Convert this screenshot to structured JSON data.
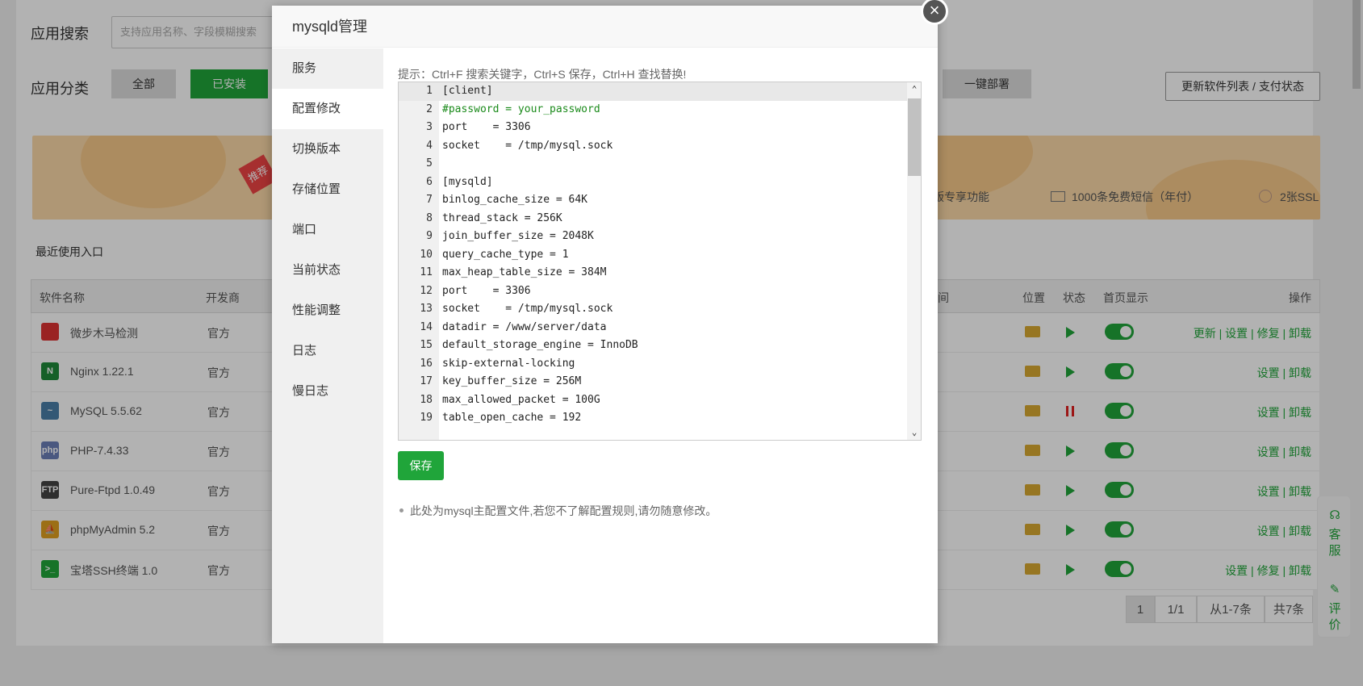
{
  "background": {
    "search_label": "应用搜索",
    "search_placeholder": "支持应用名称、字段模糊搜索",
    "category_label": "应用分类",
    "categories": [
      "全部",
      "已安装"
    ],
    "deploy_button": "一键部署",
    "update_button": "更新软件列表 / 支付状态",
    "banner_tag": "推荐",
    "banner_features": [
      "版专享功能",
      "1000条免费短信（年付）",
      "2张SSL"
    ],
    "recent_label": "最近使用入口",
    "table_headers": [
      "软件名称",
      "开发商",
      "间",
      "位置",
      "状态",
      "首页显示",
      "操作"
    ],
    "rows": [
      {
        "name": "微步木马检测",
        "dev": "官方",
        "icon": "shield-icon",
        "icon_text": "",
        "icon_color": "#d33",
        "status": "play",
        "ops": "更新 | 设置 | 修复 | 卸载"
      },
      {
        "name": "Nginx 1.22.1",
        "dev": "官方",
        "icon": "nginx-icon",
        "icon_text": "N",
        "icon_color": "#1f8a3a",
        "status": "play",
        "ops": "设置 | 卸载"
      },
      {
        "name": "MySQL 5.5.62",
        "dev": "官方",
        "icon": "mysql-dolphin-icon",
        "icon_text": "~",
        "icon_color": "#4a7fa8",
        "status": "pause",
        "ops": "设置 | 卸载"
      },
      {
        "name": "PHP-7.4.33",
        "dev": "官方",
        "icon": "php-icon",
        "icon_text": "php",
        "icon_color": "#6a7fb8",
        "status": "play",
        "ops": "设置 | 卸载"
      },
      {
        "name": "Pure-Ftpd 1.0.49",
        "dev": "官方",
        "icon": "ftp-icon",
        "icon_text": "FTP",
        "icon_color": "#444",
        "status": "play",
        "ops": "设置 | 卸载"
      },
      {
        "name": "phpMyAdmin 5.2",
        "dev": "官方",
        "icon": "phpmyadmin-icon",
        "icon_text": "⛵",
        "icon_color": "#e0a020",
        "status": "play",
        "ops": "设置 | 卸载"
      },
      {
        "name": "宝塔SSH终端 1.0",
        "dev": "官方",
        "icon": "terminal-icon",
        "icon_text": ">_",
        "icon_color": "#20a53a",
        "status": "play",
        "ops": "设置 | 修复 | 卸载"
      }
    ],
    "pager": {
      "current": "1",
      "pages": "1/1",
      "range": "从1-7条",
      "total": "共7条"
    },
    "service": {
      "kefu": "客服",
      "pingjia": "评价"
    }
  },
  "modal": {
    "title": "mysqld管理",
    "close_glyph": "×",
    "menu": [
      "服务",
      "配置修改",
      "切换版本",
      "存储位置",
      "端口",
      "当前状态",
      "性能调整",
      "日志",
      "慢日志"
    ],
    "active_menu_index": 1,
    "hint": "提示：Ctrl+F 搜索关键字，Ctrl+S 保存，Ctrl+H 查找替换!",
    "editor_lines": [
      "[client]",
      "#password = your_password",
      "port    = 3306",
      "socket    = /tmp/mysql.sock",
      "",
      "[mysqld]",
      "binlog_cache_size = 64K",
      "thread_stack = 256K",
      "join_buffer_size = 2048K",
      "query_cache_type = 1",
      "max_heap_table_size = 384M",
      "port    = 3306",
      "socket    = /tmp/mysql.sock",
      "datadir = /www/server/data",
      "default_storage_engine = InnoDB",
      "skip-external-locking",
      "key_buffer_size = 256M",
      "max_allowed_packet = 100G",
      "table_open_cache = 192"
    ],
    "save_button": "保存",
    "note": "此处为mysql主配置文件,若您不了解配置规则,请勿随意修改。"
  }
}
